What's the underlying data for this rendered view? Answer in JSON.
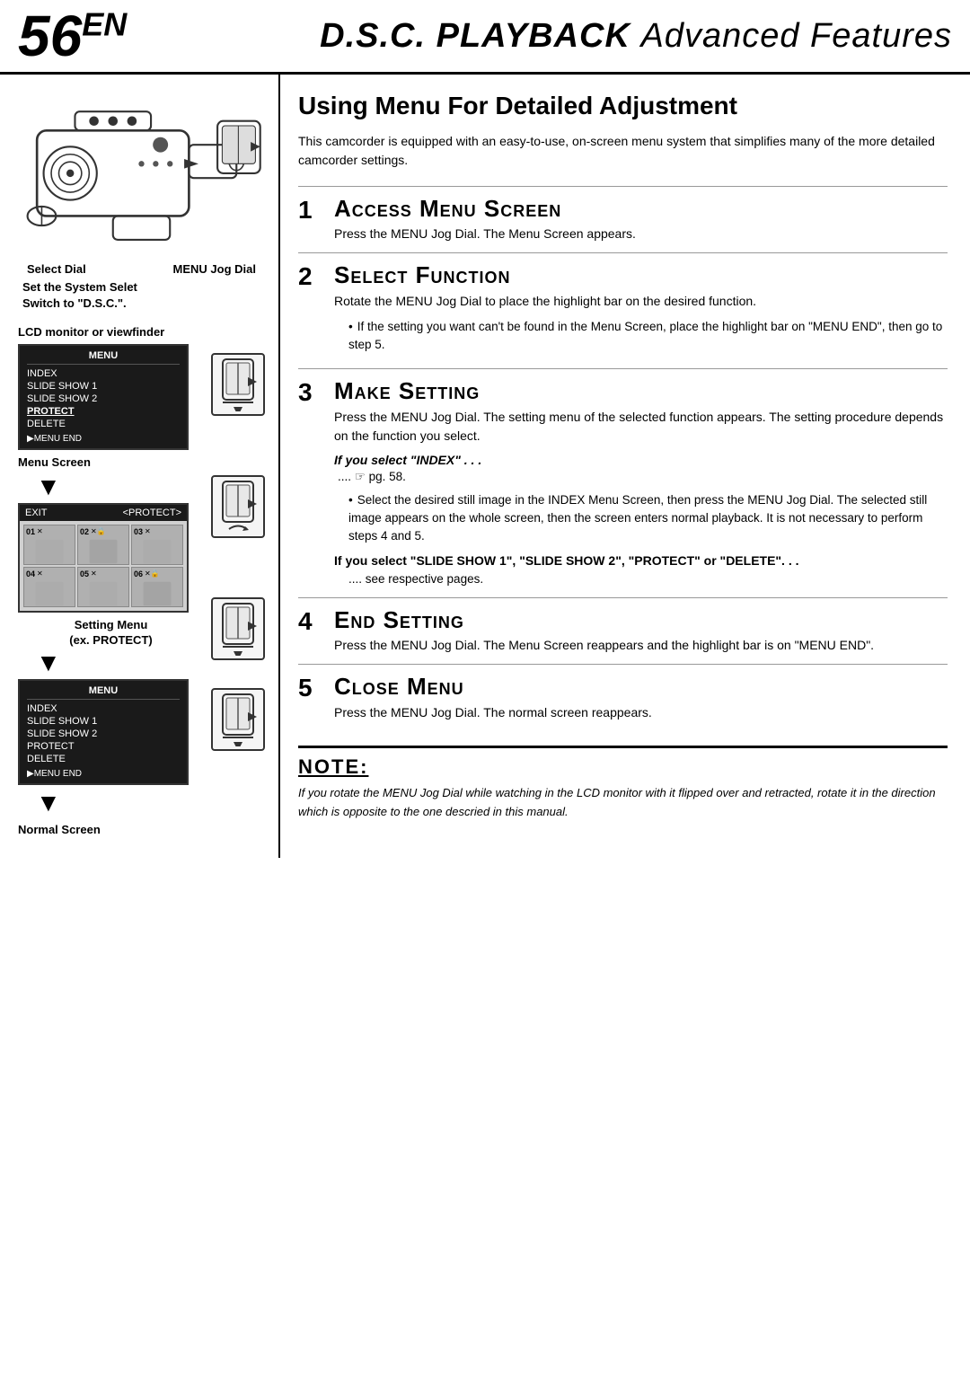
{
  "header": {
    "page_number": "56",
    "page_number_suffix": "EN",
    "title_dsc": "D.S.C.",
    "title_playback": "PLAYBACK",
    "title_rest": "Advanced Features"
  },
  "left_col": {
    "dial_label_select": "Select Dial",
    "dial_label_menu": "MENU Jog Dial",
    "system_label_line1": "Set the System Selet",
    "system_label_line2": "Switch to \"D.S.C.\".",
    "lcd_label": "LCD monitor or viewfinder",
    "menu_screen": {
      "title": "MENU",
      "items": [
        "INDEX",
        "SLIDE SHOW 1",
        "SLIDE SHOW 2",
        "PROTECT",
        "DELETE"
      ],
      "highlighted_index": 3,
      "footer": "▶MENU END"
    },
    "menu_screen_label": "Menu Screen",
    "protect_header_exit": "EXIT",
    "protect_header_name": "<PROTECT>",
    "protect_cells": [
      {
        "num": "01",
        "icons": "✕"
      },
      {
        "num": "02",
        "icons": "✕ 🔒"
      },
      {
        "num": "03",
        "icons": "✕"
      },
      {
        "num": "04",
        "icons": "✕"
      },
      {
        "num": "05",
        "icons": "✕"
      },
      {
        "num": "06",
        "icons": "✕ 🔒"
      }
    ],
    "setting_menu_label": "Setting Menu",
    "setting_menu_ex": "(ex. PROTECT)",
    "menu_screen2_title": "MENU",
    "menu_screen2_items": [
      "INDEX",
      "SLIDE SHOW 1",
      "SLIDE SHOW 2",
      "PROTECT",
      "DELETE"
    ],
    "menu_screen2_footer": "▶MENU END",
    "normal_screen_label": "Normal Screen"
  },
  "right_col": {
    "section_title": "Using Menu For Detailed Adjustment",
    "intro": "This camcorder is equipped with an easy-to-use, on-screen menu system that simplifies many of the more detailed camcorder settings.",
    "steps": [
      {
        "number": "1",
        "heading": "Access Menu Screen",
        "text": "Press the MENU Jog Dial. The Menu Screen appears."
      },
      {
        "number": "2",
        "heading": "Select Function",
        "text": "Rotate the MENU Jog Dial to place the highlight bar on the desired function.",
        "bullet": "If the setting you want can't be found in the Menu Screen, place the highlight bar on \"MENU END\", then go to step 5."
      },
      {
        "number": "3",
        "heading": "Make Setting",
        "text": "Press the MENU Jog Dial. The setting menu of the selected function appears. The setting procedure depends on the function you select.",
        "sub_sections": [
          {
            "heading": "If you select \"INDEX\" . . .",
            "page_ref": "....  pg. 58.",
            "bullets": [
              "Select the desired still image in the INDEX Menu Screen, then press the MENU Jog Dial. The selected still image appears on the whole screen, then the screen enters normal playback. It is not necessary to perform steps 4 and 5."
            ]
          },
          {
            "heading": "If you select \"SLIDE SHOW 1\", \"SLIDE SHOW 2\", \"PROTECT\" or \"DELETE\". . .",
            "text": ".... see respective pages."
          }
        ]
      },
      {
        "number": "4",
        "heading": "End Setting",
        "text": "Press the MENU Jog Dial. The Menu Screen reappears and the highlight bar is on \"MENU END\"."
      },
      {
        "number": "5",
        "heading": "Close Menu",
        "text": "Press the MENU Jog Dial. The normal screen reappears."
      }
    ],
    "note": {
      "title": "NOTE:",
      "text": "If you rotate the MENU Jog Dial while watching in the LCD monitor with it flipped over and retracted, rotate it in the direction which is opposite to the one descried in this manual."
    }
  }
}
